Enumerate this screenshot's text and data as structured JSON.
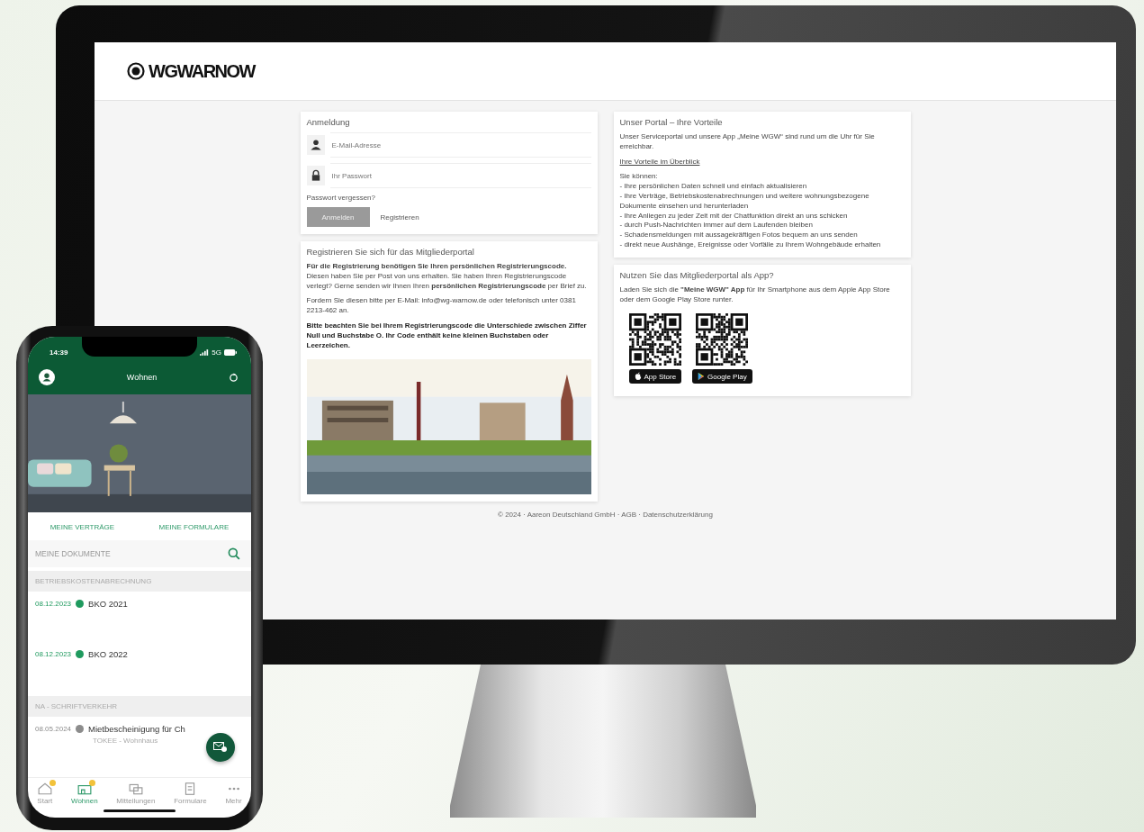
{
  "desktop": {
    "logo": "WGWARNOW",
    "login": {
      "title": "Anmeldung",
      "email_placeholder": "E-Mail-Adresse",
      "password_placeholder": "Ihr Passwort",
      "forgot_link": "Passwort vergessen?",
      "login_button": "Anmelden",
      "register_link": "Registrieren"
    },
    "register": {
      "title": "Registrieren Sie sich für das Mitgliederportal",
      "paragraphs": [
        {
          "text": "**Für die Registrierung benötigen Sie Ihren persönlichen Registrierungscode.** Diesen haben Sie per Post von uns erhalten. Sie haben Ihren Registrierungscode verlegt? Gerne senden wir Ihnen Ihren **persönlichen Registrierungscode** per Brief zu.",
          "bold": false
        },
        {
          "text": "Fordern Sie diesen bitte per E-Mail: info@wg-warnow.de oder telefonisch unter 0381 2213-462 an.",
          "bold": false
        },
        {
          "text": "Bitte beachten Sie bei Ihrem Registrierungscode die Unterschiede zwischen Ziffer Null und Buchstabe O. Ihr Code enthält keine kleinen Buchstaben oder Leerzeichen.",
          "bold": true
        }
      ]
    },
    "portal": {
      "title": "Unser Portal – Ihre Vorteile",
      "intro": "Unser Serviceportal und unsere App „Meine WGW“ sind rund um die Uhr für Sie erreichbar.",
      "link": "Ihre Vorteile im Überblick",
      "lead": "Sie können:",
      "benefits": [
        "- Ihre persönlichen Daten schnell und einfach aktualisieren",
        "- Ihre Verträge, Betriebskostenabrechnungen und weitere wohnungsbezogene Dokumente einsehen und herunterladen",
        "- Ihre Anliegen zu jeder Zeit mit der Chatfunktion direkt an uns schicken",
        "- durch Push-Nachrichten immer auf dem Laufenden bleiben",
        "- Schadensmeldungen mit aussagekräftigen Fotos bequem an uns senden",
        "- direkt neue Aushänge, Ereignisse oder Vorfälle zu Ihrem Wohngebäude erhalten"
      ]
    },
    "app": {
      "title": "Nutzen Sie das Mitgliederportal als App?",
      "text": "Laden Sie sich die **\"Meine WGW\" App** für Ihr Smartphone aus dem Apple App Store oder dem Google Play Store runter.",
      "stores": [
        {
          "kind": "apple",
          "label": "App Store"
        },
        {
          "kind": "google",
          "label": "Google Play"
        }
      ]
    },
    "footer": "© 2024 · Aareon Deutschland GmbH · AGB · Datenschutzerklärung"
  },
  "phone": {
    "time": "14:39",
    "network": "5G",
    "title": "Wohnen",
    "links": [
      "MEINE VERTRÄGE",
      "MEINE FORMULARE"
    ],
    "documents_title": "MEINE DOKUMENTE",
    "sections": [
      {
        "title": "BETRIEBSKOSTENABRECHNUNG",
        "items": [
          {
            "date": "08.12.2023",
            "title": "BKO 2021",
            "color": "#1f9a5e"
          },
          {
            "date": "08.12.2023",
            "title": "BKO 2022",
            "color": "#1f9a5e"
          }
        ]
      },
      {
        "title": "NA - SCHRIFTVERKEHR",
        "items": [
          {
            "date": "08.05.2024",
            "title": "Mietbescheinigung für Ch",
            "subtitle": "TOKEE - Wohnhaus",
            "color": "#8c8c8c"
          }
        ]
      }
    ],
    "nav": [
      {
        "kind": "home",
        "label": "Start",
        "badge": true,
        "selected": false
      },
      {
        "kind": "house",
        "label": "Wohnen",
        "badge": true,
        "selected": true
      },
      {
        "kind": "messages",
        "label": "Mitteilungen",
        "badge": false,
        "selected": false
      },
      {
        "kind": "form",
        "label": "Formulare",
        "badge": false,
        "selected": false
      },
      {
        "kind": "more",
        "label": "Mehr",
        "badge": false,
        "selected": false
      }
    ]
  }
}
